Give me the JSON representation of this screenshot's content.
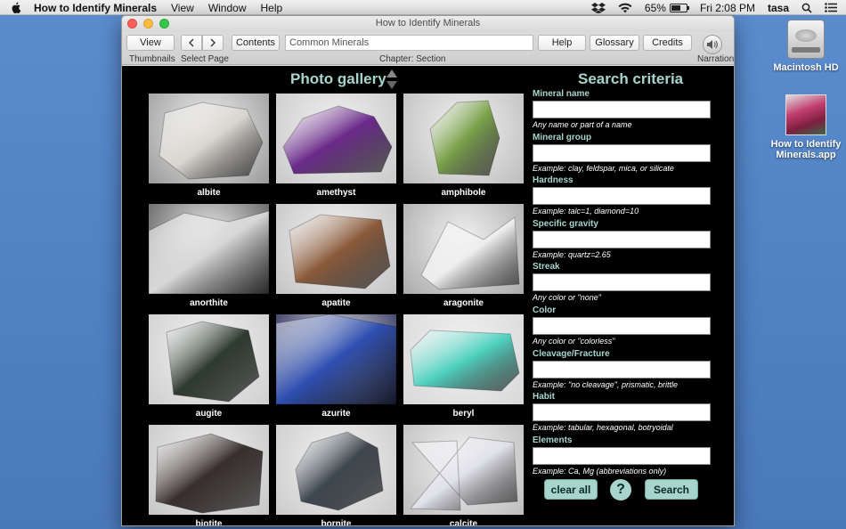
{
  "menubar": {
    "app_name": "How to Identify Minerals",
    "items": [
      "View",
      "Window",
      "Help"
    ],
    "battery": "65%",
    "battery_level": 0.65,
    "clock": "Fri 2:08 PM",
    "user": "tasa"
  },
  "desktop": {
    "hd_label": "Macintosh HD",
    "app_label_line1": "How to Identify",
    "app_label_line2": "Minerals.app"
  },
  "window": {
    "title": "How to Identify Minerals"
  },
  "toolbar": {
    "view_label": "View",
    "contents_label": "Contents",
    "chapter_value": "Common Minerals",
    "help_label": "Help",
    "glossary_label": "Glossary",
    "credits_label": "Credits",
    "thumbnails_label": "Thumbnails",
    "select_page_label": "Select Page",
    "chapter_section_label": "Chapter: Section",
    "narration_label": "Narration"
  },
  "gallery": {
    "title": "Photo gallery",
    "items": [
      {
        "name": "albite",
        "bg": "#9a9a9a",
        "color": "#d9d6d0"
      },
      {
        "name": "amethyst",
        "bg": "#c9c9c9",
        "color": "#6b2a8a"
      },
      {
        "name": "amphibole",
        "bg": "#bdbdbd",
        "color": "#7aa14a"
      },
      {
        "name": "anorthite",
        "bg": "#5a5a5a",
        "color": "#d7d7d7"
      },
      {
        "name": "apatite",
        "bg": "#c4c4c4",
        "color": "#8a5a3a"
      },
      {
        "name": "aragonite",
        "bg": "#aaaaaa",
        "color": "#eeeeee"
      },
      {
        "name": "augite",
        "bg": "#cfcfcf",
        "color": "#2e3a30"
      },
      {
        "name": "azurite",
        "bg": "#2a2f5a",
        "color": "#2f4fb0"
      },
      {
        "name": "beryl",
        "bg": "#d8d8d8",
        "color": "#4fd1c0"
      },
      {
        "name": "biotite",
        "bg": "#c6c6c6",
        "color": "#3a2e2e"
      },
      {
        "name": "bornite",
        "bg": "#cbcbcb",
        "color": "#3e4650"
      },
      {
        "name": "calcite",
        "bg": "#bdbdbd",
        "color": "#e2e2ea"
      }
    ]
  },
  "search": {
    "title": "Search criteria",
    "fields": [
      {
        "label": "Mineral name",
        "hint": "Any name or part of a name"
      },
      {
        "label": "Mineral group",
        "hint": "Example: clay, feldspar, mica, or silicate"
      },
      {
        "label": "Hardness",
        "hint": "Example: talc=1, diamond=10"
      },
      {
        "label": "Specific gravity",
        "hint": "Example: quartz=2.65"
      },
      {
        "label": "Streak",
        "hint": "Any color or \"none\""
      },
      {
        "label": "Color",
        "hint": "Any color or \"colorless\""
      },
      {
        "label": "Cleavage/Fracture",
        "hint": "Example: \"no cleavage\", prismatic, brittle"
      },
      {
        "label": "Habit",
        "hint": "Example: tabular, hexagonal, botryoidal"
      },
      {
        "label": "Elements",
        "hint": "Example: Ca, Mg (abbreviations only)"
      }
    ],
    "clear_label": "clear all",
    "help_symbol": "?",
    "search_label": "Search"
  }
}
